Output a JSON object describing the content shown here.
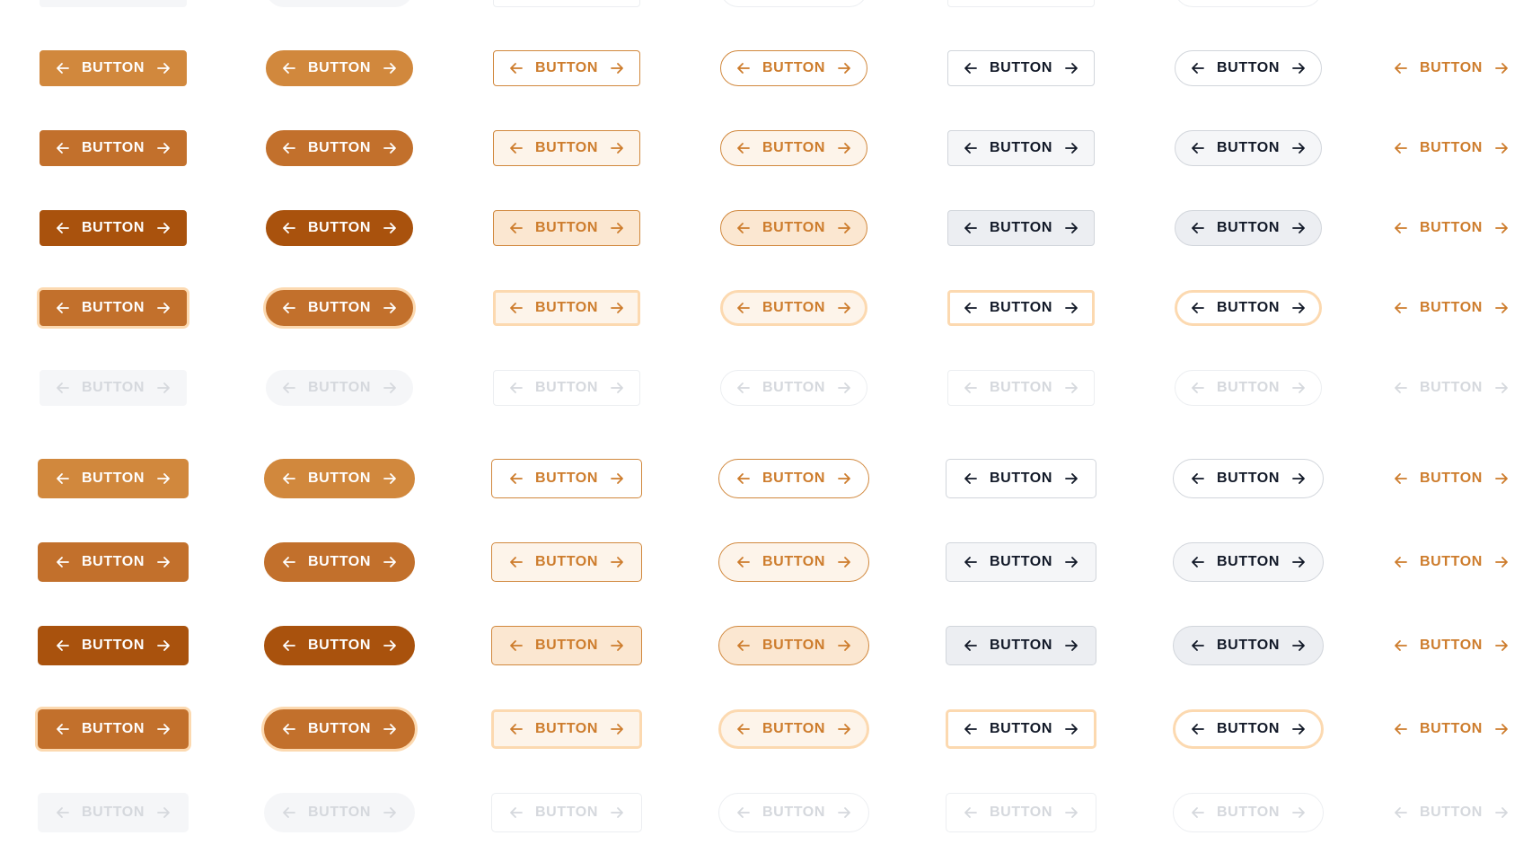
{
  "button_label": "BUTTON",
  "icons": {
    "left": "arrow-left-icon",
    "right": "arrow-right-icon"
  },
  "colors": {
    "primary": "#d1883d",
    "primary_hover": "#c2702c",
    "primary_pressed": "#a9520d",
    "primary_text": "#ffffff",
    "focus_ring": "#fcd9b0",
    "outline_text": "#cd7c2c",
    "outline_border": "#d1883d",
    "soft_bg_hover": "#fdf4ea",
    "soft_bg_pressed": "#fbe7d1",
    "neutral_text": "#111827",
    "neutral_border": "#d1d5db",
    "neutral_bg_hover": "#f5f6f8",
    "neutral_bg_pressed": "#eceef2",
    "disabled_text": "#d5d8dd",
    "disabled_bg": "#f5f6f8",
    "disabled_border": "#eceef1",
    "ghost_text": "#cd7c2c"
  },
  "variants": [
    "solid-square",
    "solid-pill",
    "outline-square",
    "outline-pill",
    "neutral-square",
    "neutral-pill",
    "text-link"
  ],
  "states": [
    "default",
    "hover",
    "pressed",
    "focus",
    "disabled"
  ],
  "sizes": [
    "md",
    "lg"
  ]
}
